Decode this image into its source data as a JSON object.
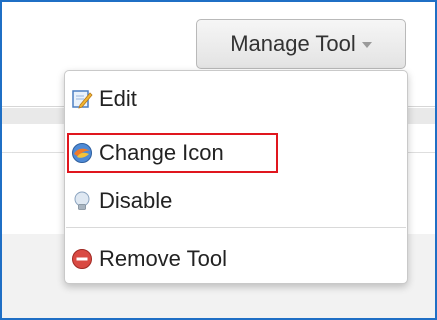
{
  "toolbar": {
    "manage_label": "Manage Tool"
  },
  "menu": {
    "items": [
      {
        "label": "Edit",
        "icon": "edit-icon"
      },
      {
        "label": "Change Icon",
        "icon": "change-icon-icon"
      },
      {
        "label": "Disable",
        "icon": "lightbulb-icon"
      },
      {
        "label": "Remove Tool",
        "icon": "remove-icon"
      }
    ]
  },
  "colors": {
    "frame_border": "#1f6fc5",
    "highlight": "#e0161e"
  }
}
